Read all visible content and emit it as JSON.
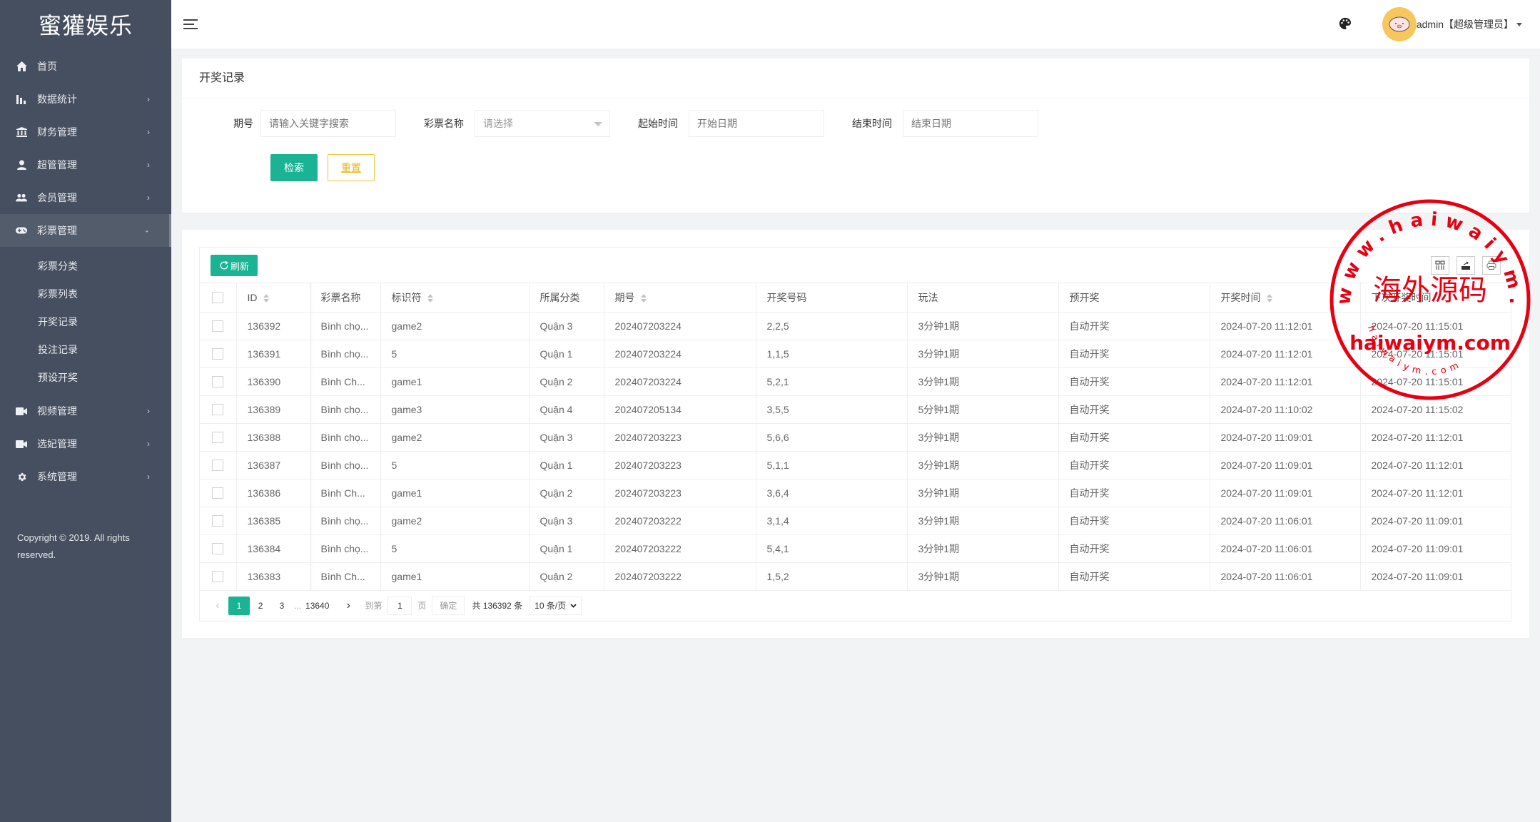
{
  "sidebar": {
    "logo": "蜜獾娱乐",
    "items": [
      {
        "label": "首页",
        "icon": "home-icon",
        "has_arrow": false
      },
      {
        "label": "数据统计",
        "icon": "bar-chart-icon",
        "has_arrow": true
      },
      {
        "label": "财务管理",
        "icon": "bank-icon",
        "has_arrow": true
      },
      {
        "label": "超管管理",
        "icon": "user-icon",
        "has_arrow": true
      },
      {
        "label": "会员管理",
        "icon": "users-icon",
        "has_arrow": true
      },
      {
        "label": "彩票管理",
        "icon": "gamepad-icon",
        "has_arrow": true,
        "open": true,
        "children": [
          "彩票分类",
          "彩票列表",
          "开奖记录",
          "投注记录",
          "预设开奖"
        ]
      },
      {
        "label": "视频管理",
        "icon": "video-icon",
        "has_arrow": true
      },
      {
        "label": "选妃管理",
        "icon": "video-icon",
        "has_arrow": true
      },
      {
        "label": "系统管理",
        "icon": "gear-icon",
        "has_arrow": true
      }
    ],
    "copyright": "Copyright © 2019. All rights reserved."
  },
  "header": {
    "user": "admin【超级管理员】"
  },
  "search": {
    "title": "开奖记录",
    "fields": {
      "issue_label": "期号",
      "issue_placeholder": "请输入关键字搜索",
      "lottery_label": "彩票名称",
      "lottery_placeholder": "请选择",
      "start_label": "起始时间",
      "start_placeholder": "开始日期",
      "end_label": "结束时间",
      "end_placeholder": "结束日期"
    },
    "search_button": "检索",
    "reset_button": "重置"
  },
  "table": {
    "refresh_button": "刷新",
    "columns": [
      "ID",
      "彩票名称",
      "标识符",
      "所属分类",
      "期号",
      "开奖号码",
      "玩法",
      "预开奖",
      "开奖时间",
      "下次开奖时间"
    ],
    "rows": [
      [
        "136392",
        "Bình chọ...",
        "game2",
        "Quận 3",
        "202407203224",
        "2,2,5",
        "3分钟1期",
        "自动开奖",
        "2024-07-20 11:12:01",
        "2024-07-20 11:15:01"
      ],
      [
        "136391",
        "Bình chọ...",
        "5",
        "Quận 1",
        "202407203224",
        "1,1,5",
        "3分钟1期",
        "自动开奖",
        "2024-07-20 11:12:01",
        "2024-07-20 11:15:01"
      ],
      [
        "136390",
        "Bình Ch...",
        "game1",
        "Quận 2",
        "202407203224",
        "5,2,1",
        "3分钟1期",
        "自动开奖",
        "2024-07-20 11:12:01",
        "2024-07-20 11:15:01"
      ],
      [
        "136389",
        "Bình chọ...",
        "game3",
        "Quận 4",
        "202407205134",
        "3,5,5",
        "5分钟1期",
        "自动开奖",
        "2024-07-20 11:10:02",
        "2024-07-20 11:15:02"
      ],
      [
        "136388",
        "Bình chọ...",
        "game2",
        "Quận 3",
        "202407203223",
        "5,6,6",
        "3分钟1期",
        "自动开奖",
        "2024-07-20 11:09:01",
        "2024-07-20 11:12:01"
      ],
      [
        "136387",
        "Bình chọ...",
        "5",
        "Quận 1",
        "202407203223",
        "5,1,1",
        "3分钟1期",
        "自动开奖",
        "2024-07-20 11:09:01",
        "2024-07-20 11:12:01"
      ],
      [
        "136386",
        "Bình Ch...",
        "game1",
        "Quận 2",
        "202407203223",
        "3,6,4",
        "3分钟1期",
        "自动开奖",
        "2024-07-20 11:09:01",
        "2024-07-20 11:12:01"
      ],
      [
        "136385",
        "Bình chọ...",
        "game2",
        "Quận 3",
        "202407203222",
        "3,1,4",
        "3分钟1期",
        "自动开奖",
        "2024-07-20 11:06:01",
        "2024-07-20 11:09:01"
      ],
      [
        "136384",
        "Bình chọ...",
        "5",
        "Quận 1",
        "202407203222",
        "5,4,1",
        "3分钟1期",
        "自动开奖",
        "2024-07-20 11:06:01",
        "2024-07-20 11:09:01"
      ],
      [
        "136383",
        "Bình Ch...",
        "game1",
        "Quận 2",
        "202407203222",
        "1,5,2",
        "3分钟1期",
        "自动开奖",
        "2024-07-20 11:06:01",
        "2024-07-20 11:09:01"
      ]
    ]
  },
  "pagination": {
    "pages": [
      "1",
      "2",
      "3"
    ],
    "ellipsis": "...",
    "last_page": "13640",
    "current": "1",
    "goto_label": "到第",
    "goto_value": "1",
    "page_suffix": "页",
    "confirm": "确定",
    "total": "共 136392 条",
    "per_page": "10 条/页"
  },
  "watermark": {
    "center_text": "海外源码",
    "middle_text": "haiwaiym.com",
    "ring_text": "www.haiwaiym.com",
    "inner_ring_text": "haiwaiym.com",
    "color": "#e60012"
  },
  "colors": {
    "sidebar_bg": "#464f5f",
    "accent": "#1ab394",
    "reset_border": "#ecc33d"
  }
}
